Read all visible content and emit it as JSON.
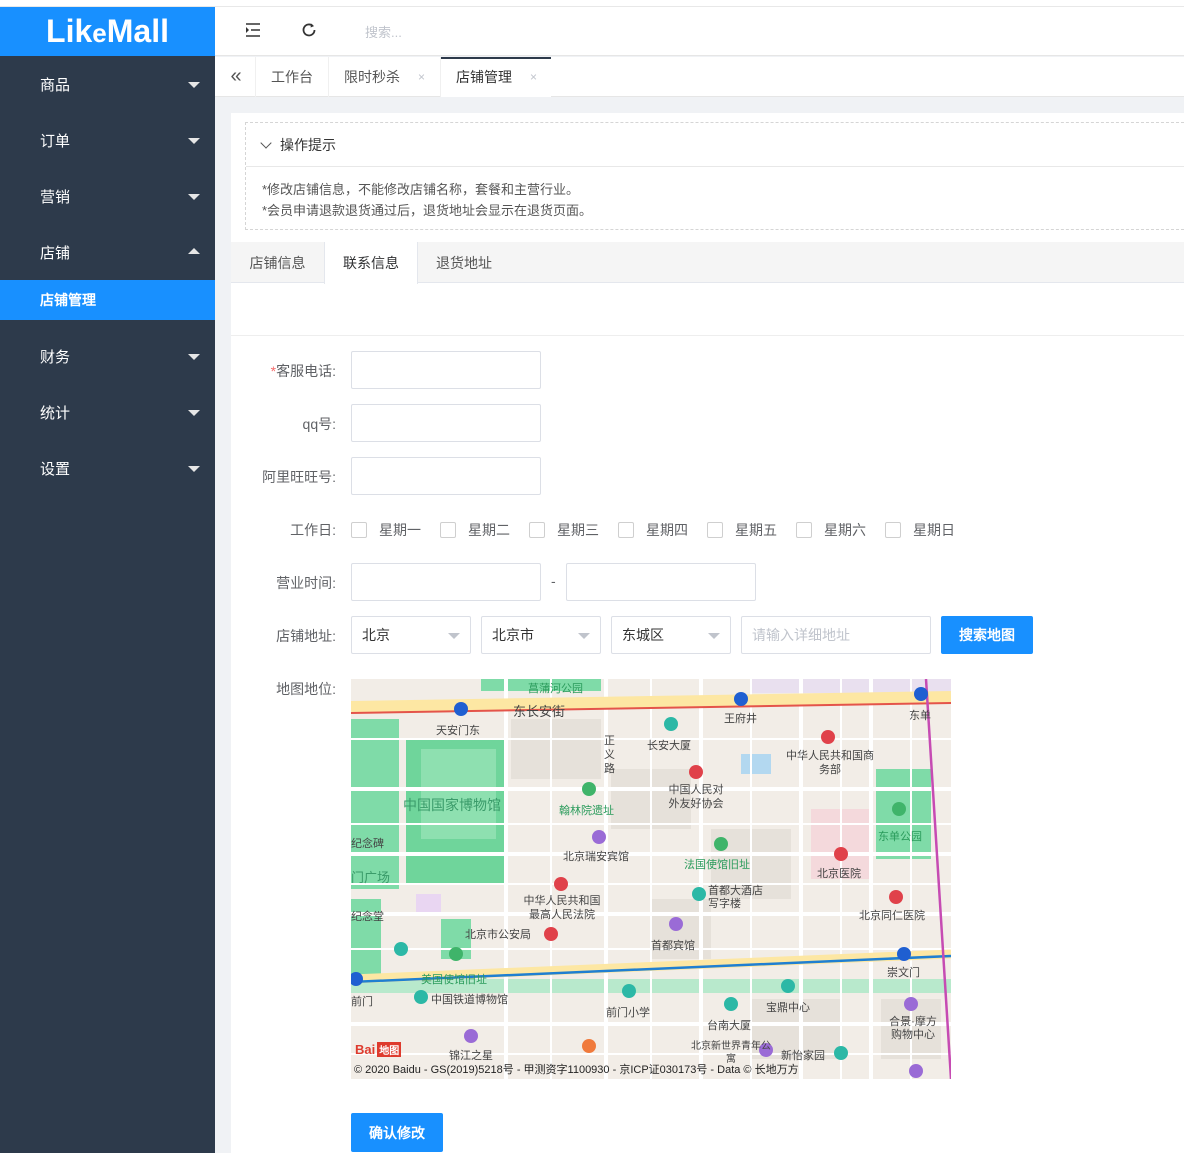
{
  "app": {
    "logo_text": "Lik",
    "logo_e": "e",
    "logo_tail": "Mall",
    "primary_color": "#1890ff",
    "sidebar_color": "#2d3a4b"
  },
  "sidebar": {
    "items": [
      {
        "label": "商品"
      },
      {
        "label": "订单"
      },
      {
        "label": "营销"
      },
      {
        "label": "店铺"
      },
      {
        "label": "财务"
      },
      {
        "label": "统计"
      },
      {
        "label": "设置"
      }
    ],
    "active_sub": "店铺管理"
  },
  "topbar": {
    "menu_icon": "menu-fold-icon",
    "refresh_icon": "refresh-icon",
    "search_placeholder": "搜索..."
  },
  "page_tabs": [
    {
      "label": "工作台"
    },
    {
      "label": "限时秒杀",
      "close": "×"
    },
    {
      "label": "店铺管理",
      "close": "×"
    }
  ],
  "tips": {
    "title": "操作提示",
    "lines": [
      "*修改店铺信息，不能修改店铺名称，套餐和主营行业。",
      "*会员申请退款退货通过后，退货地址会显示在退货页面。"
    ]
  },
  "content_tabs": [
    {
      "label": "店铺信息"
    },
    {
      "label": "联系信息"
    },
    {
      "label": "退货地址"
    }
  ],
  "form": {
    "phone": {
      "required_mark": "*",
      "label": "客服电话:",
      "value": ""
    },
    "qq": {
      "label": "qq号:",
      "value": ""
    },
    "wangwang": {
      "label": "阿里旺旺号:",
      "value": ""
    },
    "workdays": {
      "label": "工作日:",
      "options": [
        "星期一",
        "星期二",
        "星期三",
        "星期四",
        "星期五",
        "星期六",
        "星期日"
      ]
    },
    "hours": {
      "label": "营业时间:",
      "separator": "-",
      "start": "",
      "end": ""
    },
    "address": {
      "label": "店铺地址:",
      "province": "北京",
      "city": "北京市",
      "district": "东城区",
      "detail_placeholder": "请输入详细地址",
      "search_button": "搜索地图"
    },
    "map": {
      "label": "地图地位:",
      "places": {
        "p1": "菖蒲河公园",
        "p2": "东长安街",
        "p3": "天安门东",
        "p4": "王府井",
        "p5": "东单",
        "p6": "长安大厦",
        "p7": "正义路",
        "p8": "中华人民共和国商务部",
        "p9": "中国国家博物馆",
        "p10": "中国人民对外友好协会",
        "p11": "翰林院遗址",
        "p12": "东单公园",
        "p13": "北京瑞安宾馆",
        "p14": "法国使馆旧址",
        "p15": "北京医院",
        "p16": "首都大酒店写字楼",
        "p17": "中华人民共和国最高人民法院",
        "p18": "北京同仁医院",
        "p19": "北京市公安局",
        "p20": "首都宾馆",
        "p21": "崇文门",
        "p22": "美国使馆旧址",
        "p23": "中国铁道博物馆",
        "p24": "前门",
        "p25": "前门小学",
        "p26": "宝鼎中心",
        "p27": "台南大厦",
        "p28": "合景·摩方购物中心",
        "p29": "锦江之星",
        "p30": "北京新世界青年公寓",
        "p31": "新怡家园",
        "p32": "门广场",
        "p33": "纪念碑",
        "p34": "纪念堂"
      },
      "logo": "Bai",
      "logo_tag": "地图",
      "copyright": "© 2020 Baidu - GS(2019)5218号 - 甲测资字1100930 - 京ICP证030173号 - Data © 长地万方"
    },
    "submit": "确认修改"
  }
}
